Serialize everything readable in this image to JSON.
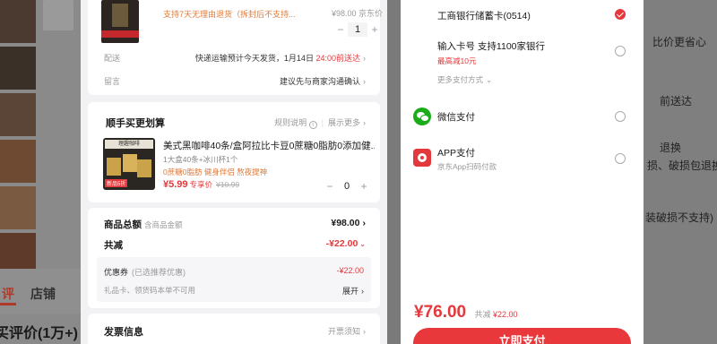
{
  "background": {
    "tabs": [
      "评",
      "店铺"
    ],
    "reviews_heading": "买评价(1万+)",
    "right_lines": [
      "比价更省心",
      "前送达",
      "退换",
      "损、破损包退换・",
      "装破损不支持)"
    ]
  },
  "product": {
    "return_note": "支持7天无理由退货（拆封后不支持...",
    "unit_price": "¥98.00 京东价",
    "quantity": "1",
    "shipping_label": "配送",
    "shipping_text": "快递运输预计今天发货，1月14日",
    "shipping_deadline": "24:00前送达",
    "note_label": "留言",
    "note_text": "建议先与商家沟通确认"
  },
  "addon": {
    "title": "顺手买更划算",
    "rules_link": "规则说明",
    "more_link": "展示更多",
    "item_title": "美式黑咖啡40条/盒阿拉比卡豆0蔗糖0脂肪0添加健...",
    "item_sub": "1大盒40条+冰川杯1个",
    "item_tags": "0蔗糖0脂肪 健身伴侣 熬夜提神",
    "price": "¥5.99",
    "price_tag": "专享价",
    "orig_price": "¥10.99",
    "quantity": "0",
    "img_label": "新品5折"
  },
  "summary": {
    "total_label": "商品总额",
    "total_hint": "含商品金额",
    "total_value": "¥98.00",
    "discount_label": "共减",
    "discount_value": "-¥22.00",
    "coupon_label": "优惠券",
    "coupon_hint": "(已选推荐优惠)",
    "coupon_value": "-¥22.00",
    "gift_label": "礼品卡、领货码本单不可用",
    "expand_label": "展开"
  },
  "invoice": {
    "title": "发票信息",
    "link": "开票须知"
  },
  "payment": {
    "methods": [
      {
        "title": "工商银行储蓄卡(0514)",
        "sub": "",
        "selected": true
      },
      {
        "title": "输入卡号 支持1100家银行",
        "sub": "最高减10元",
        "selected": false
      },
      {
        "title": "微信支付",
        "sub": "",
        "selected": false
      },
      {
        "title": "APP支付",
        "sub": "京东App扫码付款",
        "selected": false
      }
    ],
    "more_methods": "更多支付方式",
    "total": "¥76.00",
    "saved_label": "共减",
    "saved_value": "¥22.00",
    "pay_button": "立即支付"
  }
}
